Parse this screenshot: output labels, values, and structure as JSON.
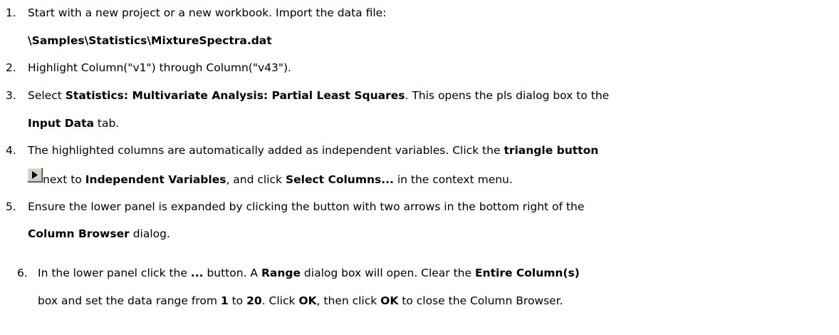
{
  "steps": [
    {
      "num": "1.",
      "line1": "Start with a new project or a new workbook. Import the data file:",
      "path": "\\Samples\\Statistics\\MixtureSpectra.dat"
    },
    {
      "num": "2.",
      "text": "Highlight Column(\"v1\") through Column(\"v43\")."
    },
    {
      "num": "3.",
      "pre": "Select ",
      "menu_path": "Statistics: Multivariate Analysis: Partial Least Squares",
      "post": ". This opens the pls dialog box to the",
      "tab_name": "Input Data",
      "tab_suffix": " tab."
    },
    {
      "num": "4.",
      "pre": "The highlighted columns are automatically added as independent variables. Click the ",
      "button_name": "triangle button",
      "next_to": "next to ",
      "field_name": "Independent Variables",
      "mid": ", and click ",
      "menu_item": "Select Columns...",
      "post": " in the context menu."
    },
    {
      "num": "5.",
      "line1": "Ensure the lower panel is expanded by clicking the button with two arrows in the bottom right of the",
      "dialog_name": "Column Browser",
      "dialog_suffix": " dialog."
    },
    {
      "num": "6.",
      "a": "In the lower panel click the ",
      "ellipsis": "...",
      "b": " button. A ",
      "range": "Range",
      "c": " dialog box will open. Clear the ",
      "entire": "Entire Column(s)",
      "d": "box and set the data range from ",
      "from": "1",
      "e": " to ",
      "to": "20",
      "f": ". Click ",
      "ok1": "OK",
      "g": ", then click ",
      "ok2": "OK",
      "h": " to close the Column Browser."
    }
  ],
  "icons": {
    "triangle_button": "play-triangle-icon"
  }
}
